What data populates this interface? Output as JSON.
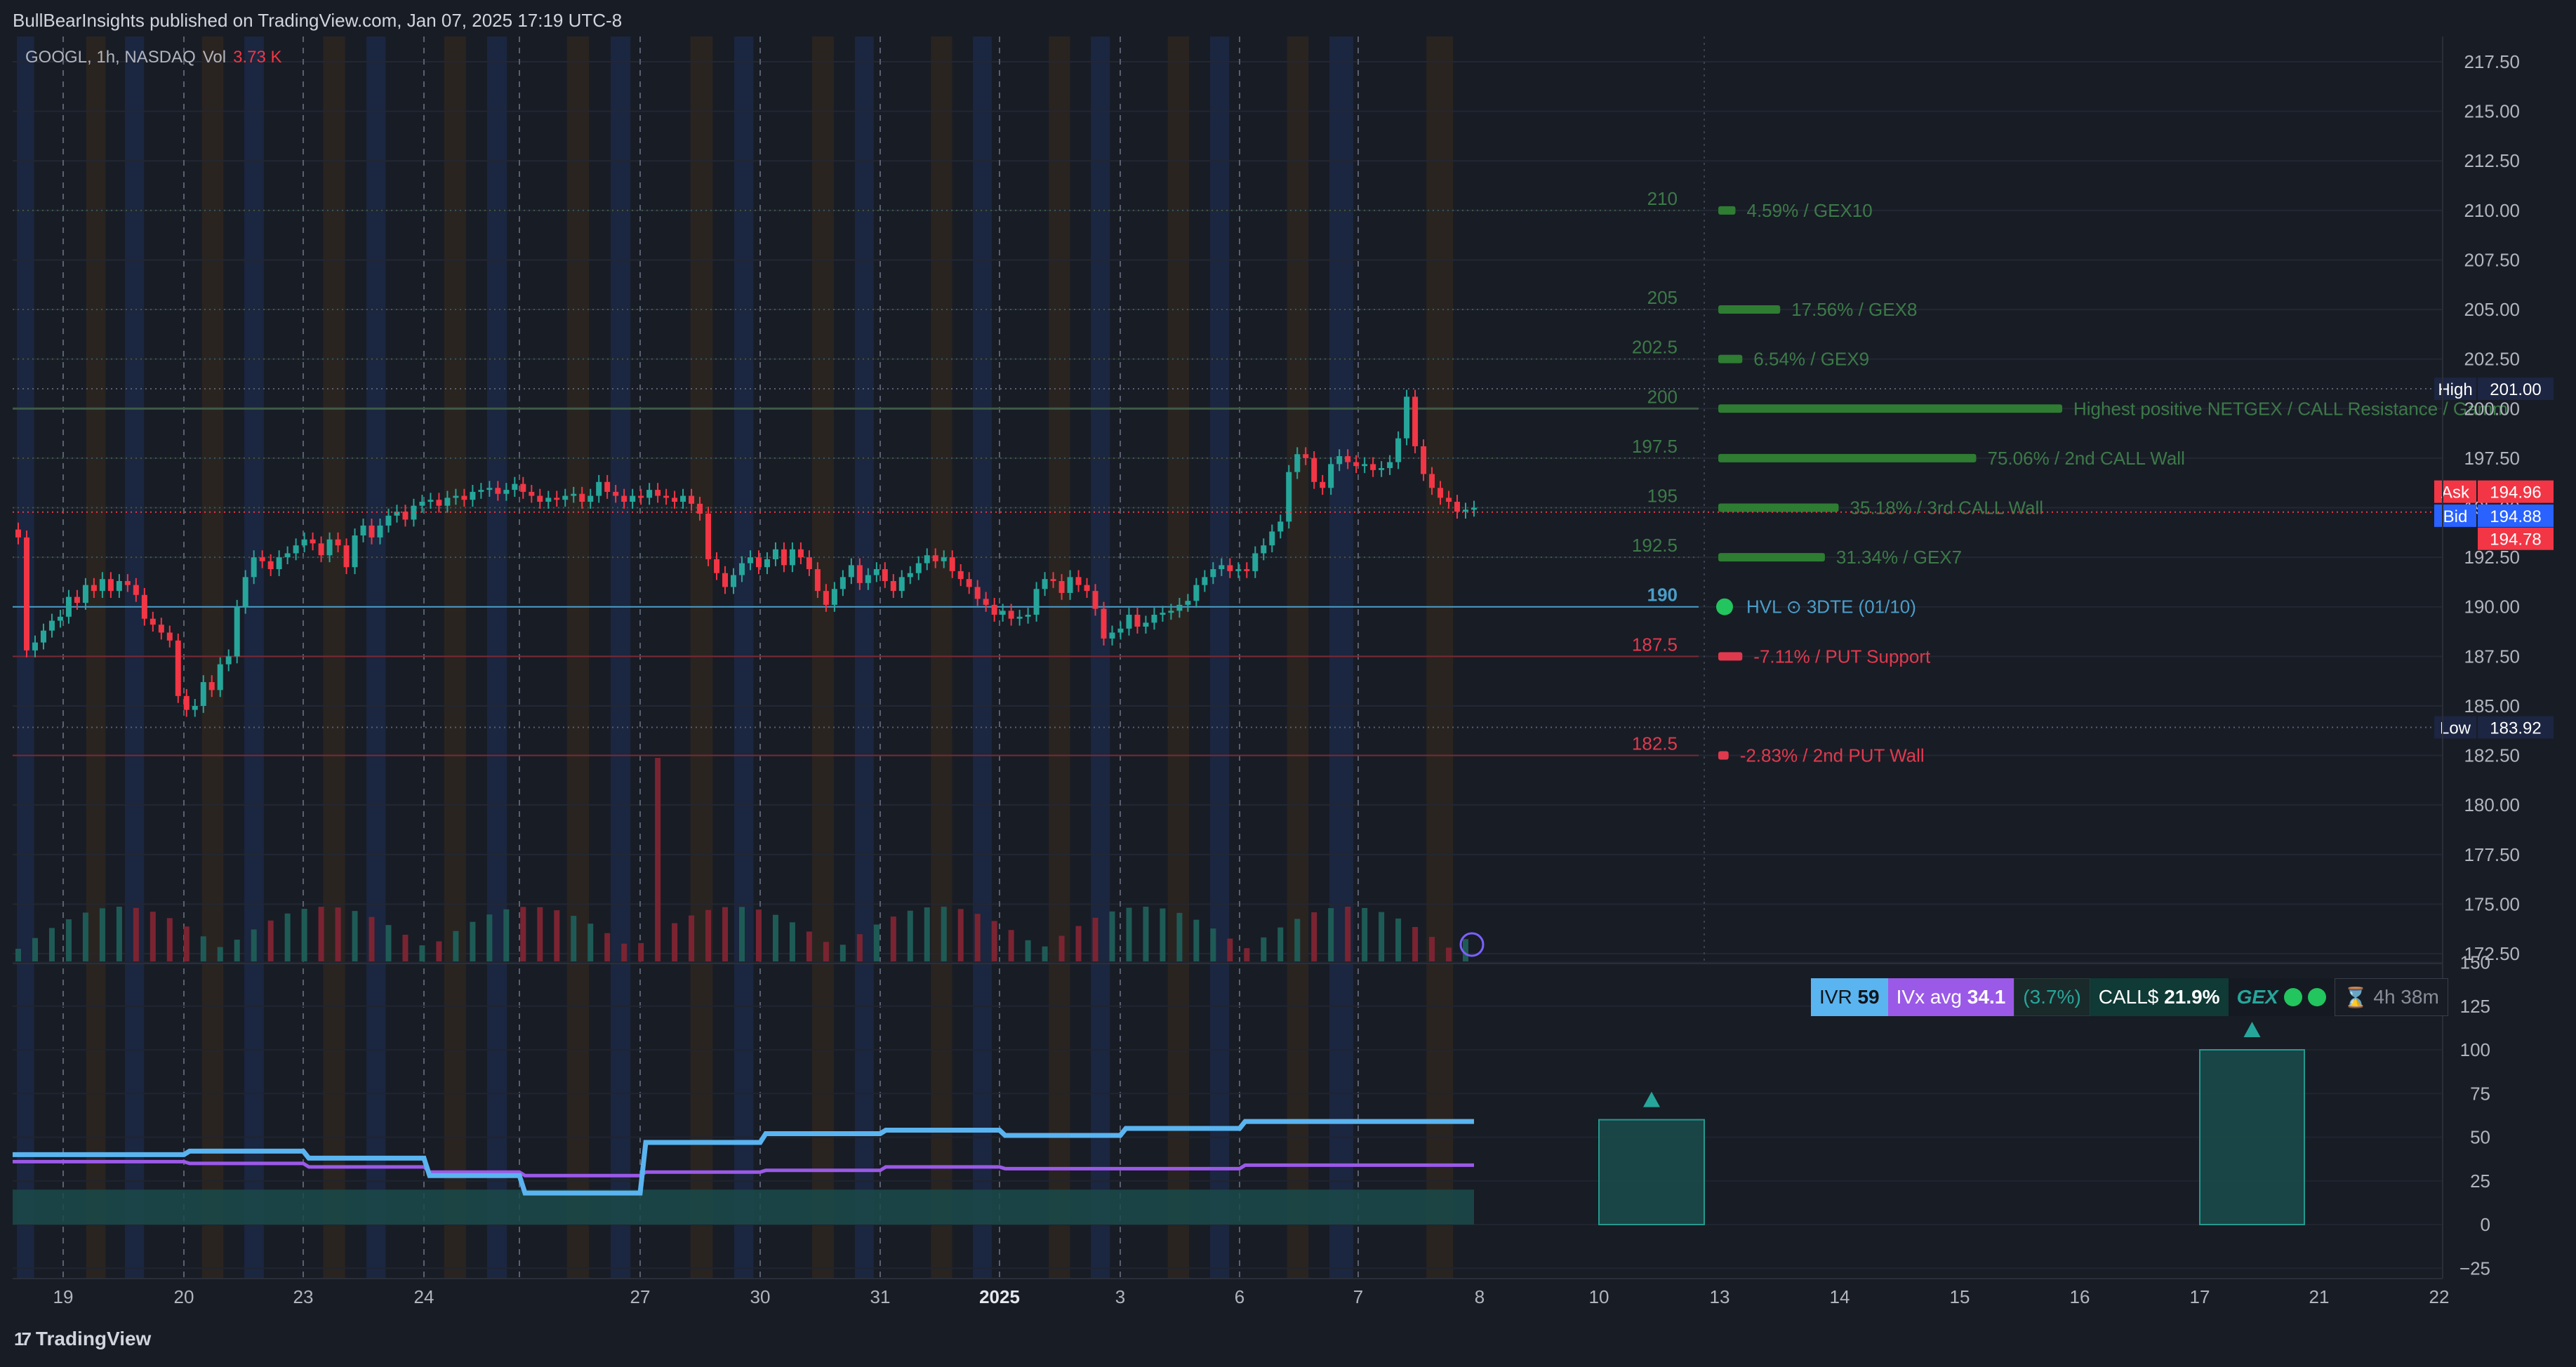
{
  "header": {
    "publisher": "BullBearInsights published on TradingView.com, Jan 07, 2025 17:19 UTC-8"
  },
  "legend": {
    "symbol": "GOOGL, 1h, NASDAQ",
    "vol_label": "Vol",
    "vol_value": "3.73 K"
  },
  "footer": {
    "brand": "TradingView",
    "logo_glyph": "17"
  },
  "indicator_strip": {
    "ivr_label": "IVR",
    "ivr_value": "59",
    "ivx_label": "IVx avg",
    "ivx_value": "34.1",
    "iv_change": "(3.7%)",
    "calls_label": "CALL$",
    "calls_value": "21.9%",
    "gex_label": "GEX",
    "timer_icon": "hourglass-icon",
    "timer_value": "4h 38m"
  },
  "colors": {
    "background": "#181c25",
    "up": "#26a69a",
    "down": "#f23645",
    "gex_green": "#2e7d32",
    "put_red": "#e0394d",
    "hvl_blue": "#4a9ec9",
    "ivr_line": "#5ab4f0",
    "ivx_line": "#9b59e8"
  },
  "chart_data": {
    "type": "candlestick",
    "price_axis": {
      "ticks": [
        "217.50",
        "215.00",
        "212.50",
        "210.00",
        "207.50",
        "205.00",
        "202.50",
        "200.00",
        "197.50",
        "195.00",
        "192.50",
        "190.00",
        "187.50",
        "185.00",
        "182.50",
        "180.00",
        "177.50",
        "175.00",
        "172.50"
      ],
      "range": [
        170,
        219
      ]
    },
    "x_axis": {
      "ticks": [
        "19",
        "20",
        "23",
        "24",
        "27",
        "30",
        "31",
        "2025",
        "3",
        "6",
        "7",
        "8",
        "10",
        "13",
        "14",
        "15",
        "16",
        "17",
        "21",
        "22"
      ]
    },
    "price_badges": [
      {
        "label": "High",
        "value": "201.00"
      },
      {
        "label": "Ask",
        "value": "194.96"
      },
      {
        "label": "Bid",
        "value": "194.88"
      },
      {
        "label": "",
        "value": "194.78"
      },
      {
        "label": "Low",
        "value": "183.92"
      }
    ],
    "gex_levels": [
      {
        "strike": "210",
        "price": 210,
        "label": "4.59% / GEX10",
        "strength": 0.05,
        "color": "#2e7d32"
      },
      {
        "strike": "205",
        "price": 205,
        "label": "17.56% / GEX8",
        "strength": 0.18,
        "color": "#2e7d32"
      },
      {
        "strike": "202.5",
        "price": 202.5,
        "label": "6.54% / GEX9",
        "strength": 0.07,
        "color": "#2e7d32"
      },
      {
        "strike": "200",
        "price": 200,
        "label": "Highest positive NETGEX / CALL Resistance / Gamm",
        "strength": 1.0,
        "color": "#2e7d32"
      },
      {
        "strike": "197.5",
        "price": 197.5,
        "label": "75.06% / 2nd CALL Wall",
        "strength": 0.75,
        "color": "#2e7d32"
      },
      {
        "strike": "195",
        "price": 195,
        "label": "35.18% / 3rd CALL Wall",
        "strength": 0.35,
        "color": "#2e7d32"
      },
      {
        "strike": "192.5",
        "price": 192.5,
        "label": "31.34% / GEX7",
        "strength": 0.31,
        "color": "#2e7d32"
      },
      {
        "strike": "190",
        "price": 190,
        "label": "HVL",
        "strength": 0,
        "color": "#4a9ec9"
      },
      {
        "strike": "187.5",
        "price": 187.5,
        "label": "-7.11% / PUT Support",
        "strength": 0.07,
        "color": "#e0394d"
      },
      {
        "strike": "182.5",
        "price": 182.5,
        "label": "-2.83% / 2nd PUT Wall",
        "strength": 0.03,
        "color": "#e0394d"
      }
    ],
    "hvl": {
      "prefix": "HVL",
      "suffix_icon": "clock-icon",
      "dte": "3DTE",
      "date": "(01/10)"
    },
    "candles_close": [
      193.5,
      187.8,
      188.2,
      188.8,
      189.3,
      189.5,
      190.5,
      190.2,
      191.1,
      190.8,
      191.4,
      190.8,
      191.3,
      191.1,
      190.6,
      189.4,
      189.1,
      188.7,
      188.3,
      185.5,
      184.8,
      185.0,
      186.2,
      185.8,
      187.1,
      187.5,
      190.0,
      191.5,
      192.5,
      192.3,
      191.9,
      192.5,
      192.7,
      193.1,
      193.4,
      193.2,
      192.6,
      193.4,
      193.1,
      192.0,
      193.6,
      194.1,
      193.5,
      194.1,
      194.6,
      194.8,
      194.4,
      195.1,
      195.3,
      195.4,
      195.1,
      195.5,
      195.6,
      195.4,
      195.8,
      195.9,
      196.0,
      195.7,
      195.9,
      196.2,
      195.8,
      195.6,
      195.3,
      195.5,
      195.4,
      195.6,
      195.7,
      195.3,
      195.6,
      196.3,
      195.8,
      195.6,
      195.3,
      195.6,
      195.5,
      195.9,
      195.6,
      195.5,
      195.3,
      195.6,
      195.2,
      194.7,
      192.4,
      191.7,
      191.0,
      191.6,
      192.2,
      192.5,
      192.0,
      192.4,
      192.9,
      192.1,
      192.9,
      192.5,
      191.9,
      190.8,
      190.1,
      190.9,
      191.5,
      192.1,
      191.2,
      191.6,
      191.9,
      191.3,
      190.8,
      191.5,
      191.7,
      192.2,
      192.6,
      192.3,
      192.5,
      191.8,
      191.4,
      191.0,
      190.4,
      190.1,
      189.6,
      189.8,
      189.4,
      189.5,
      189.6,
      190.9,
      191.4,
      191.3,
      190.7,
      191.5,
      191.1,
      190.8,
      189.9,
      188.4,
      188.7,
      188.9,
      189.6,
      189.0,
      189.2,
      189.6,
      189.7,
      189.8,
      190.1,
      190.3,
      191.1,
      191.5,
      191.9,
      192.1,
      191.8,
      191.9,
      191.8,
      192.7,
      193.1,
      193.8,
      194.3,
      196.8,
      197.7,
      197.5,
      196.3,
      196.0,
      197.2,
      197.6,
      197.3,
      197.1,
      197.2,
      196.9,
      197.0,
      197.3,
      198.5,
      200.6,
      198.1,
      196.7,
      196.0,
      195.5,
      195.3,
      194.8,
      194.9,
      195.0
    ],
    "volume_bars": "86 bars, heights proportional to volume, colored by candle direction",
    "lower_pane": {
      "y_ticks": [
        "150",
        "125",
        "100",
        "75",
        "50",
        "25",
        "0",
        "−25"
      ],
      "y_range": [
        -35,
        150
      ],
      "ivr_series": {
        "name": "IVR",
        "x": [
          "19",
          "20",
          "23",
          "24",
          "27",
          "30",
          "31",
          "2025",
          "3",
          "6",
          "7",
          "8"
        ],
        "values": [
          40,
          42,
          38,
          28,
          18,
          47,
          52,
          54,
          51,
          55,
          59,
          59
        ]
      },
      "ivx_series": {
        "name": "IVx avg",
        "x": [
          "19",
          "20",
          "23",
          "24",
          "27",
          "30",
          "31",
          "2025",
          "3",
          "6",
          "7",
          "8"
        ],
        "values": [
          36,
          35,
          33,
          30,
          28,
          30,
          31,
          33,
          32,
          32,
          34,
          34
        ]
      },
      "gex_boxes": [
        {
          "x_from": "10",
          "x_to": "13",
          "value": 60
        },
        {
          "x_from": "17",
          "x_to": "21",
          "value": 100
        }
      ]
    }
  }
}
